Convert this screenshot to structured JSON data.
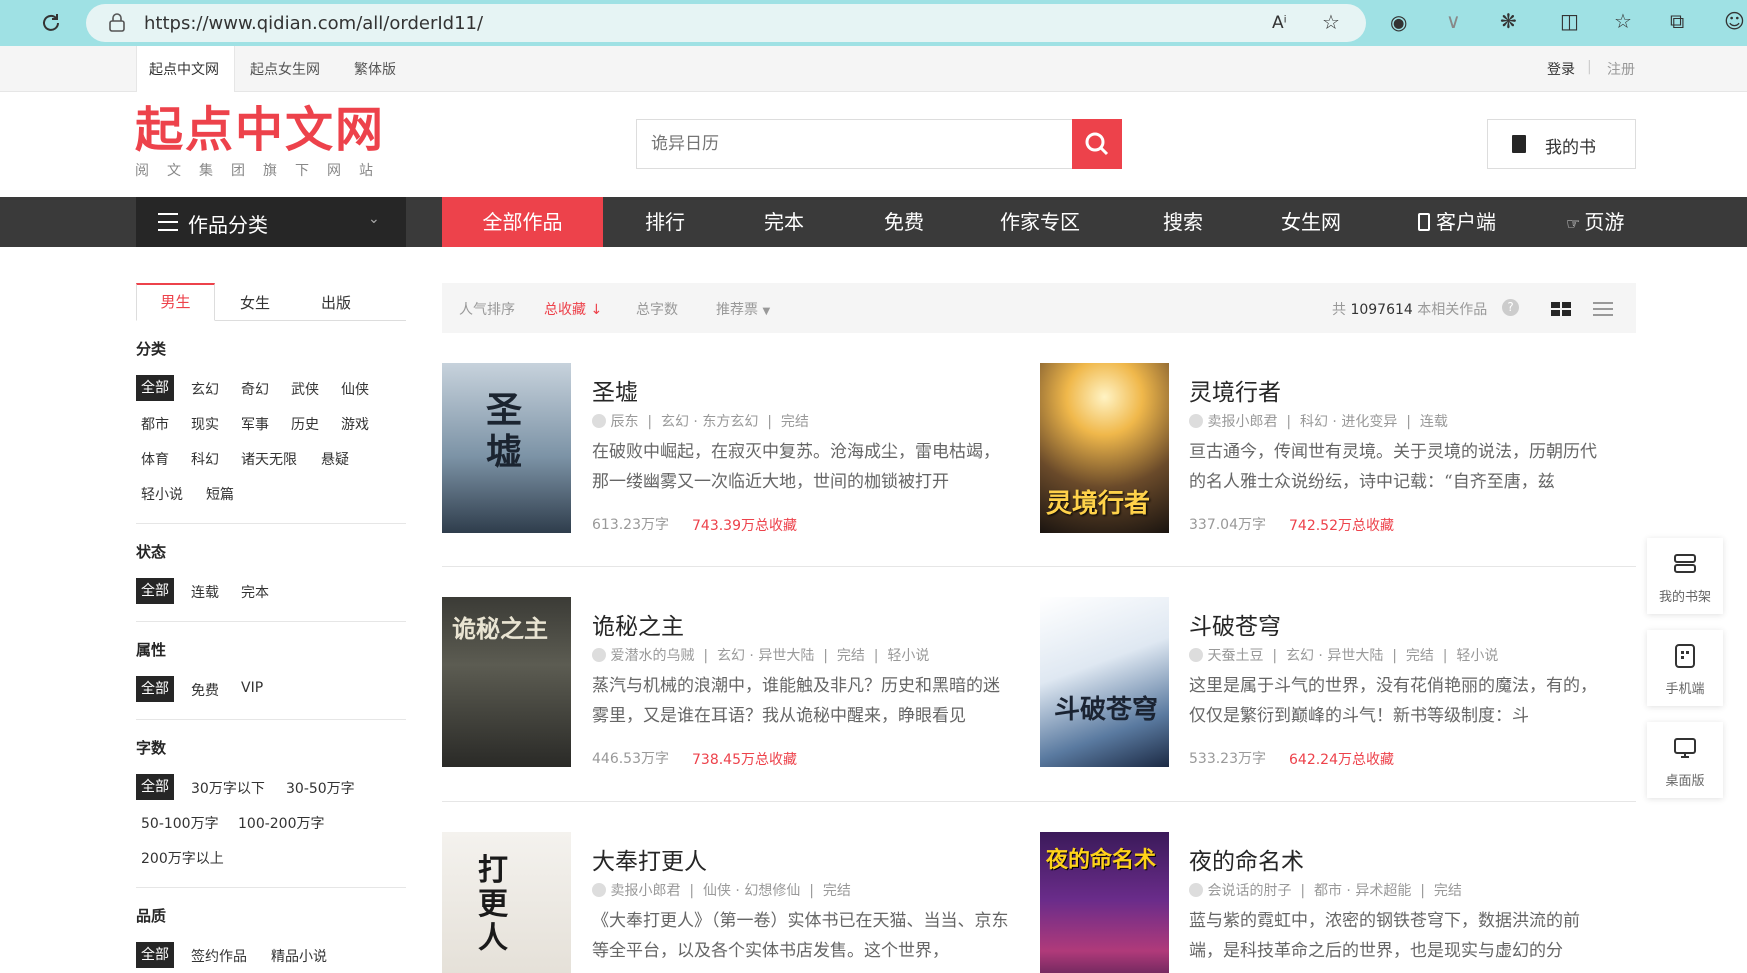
{
  "browser": {
    "url": "https://www.qidian.com/all/orderId11/"
  },
  "topbar": {
    "links": [
      "起点中文网",
      "起点女生网",
      "繁体版"
    ],
    "login": "登录",
    "register": "注册"
  },
  "header": {
    "logo_title": "起点中文网",
    "logo_subtitle": "阅文集团旗下网站",
    "search_placeholder": "诡异日历",
    "mybook_label": "我的书"
  },
  "nav": {
    "category_label": "作品分类",
    "items": [
      "全部作品",
      "排行",
      "完本",
      "免费",
      "作家专区",
      "搜索",
      "女生网",
      "客户端",
      "页游"
    ]
  },
  "filters": {
    "tabs": [
      "男生",
      "女生",
      "出版"
    ],
    "groups": [
      {
        "title": "分类",
        "options": [
          "全部",
          "玄幻",
          "奇幻",
          "武侠",
          "仙侠",
          "都市",
          "现实",
          "军事",
          "历史",
          "游戏",
          "体育",
          "科幻",
          "诸天无限",
          "悬疑",
          "轻小说",
          "短篇"
        ]
      },
      {
        "title": "状态",
        "options": [
          "全部",
          "连载",
          "完本"
        ]
      },
      {
        "title": "属性",
        "options": [
          "全部",
          "免费",
          "VIP"
        ]
      },
      {
        "title": "字数",
        "options": [
          "全部",
          "30万字以下",
          "30-50万字",
          "50-100万字",
          "100-200万字",
          "200万字以上"
        ]
      },
      {
        "title": "品质",
        "options": [
          "全部",
          "签约作品",
          "精品小说"
        ]
      }
    ]
  },
  "sortbar": {
    "options": [
      "人气排序",
      "总收藏",
      "总字数",
      "推荐票"
    ],
    "active": "总收藏",
    "total_prefix": "共",
    "total_count": "1097614",
    "total_suffix": "本相关作品"
  },
  "books": [
    {
      "title": "圣墟",
      "author": "辰东",
      "cat": "玄幻",
      "subcat": "东方玄幻",
      "status": "完结",
      "tag": "",
      "desc": "在破败中崛起，在寂灭中复苏。沧海成尘，雷电枯竭，那一缕幽雾又一次临近大地，世间的枷锁被打开",
      "words": "613.23万字",
      "collect": "743.39万总收藏",
      "cover_text": "圣墟"
    },
    {
      "title": "灵境行者",
      "author": "卖报小郎君",
      "cat": "科幻",
      "subcat": "进化变异",
      "status": "连载",
      "tag": "",
      "desc": "亘古通今，传闻世有灵境。关于灵境的说法，历朝历代的名人雅士众说纷纭，诗中记载：“自齐至唐，兹",
      "words": "337.04万字",
      "collect": "742.52万总收藏",
      "cover_text": "灵境行者"
    },
    {
      "title": "诡秘之主",
      "author": "爱潜水的乌贼",
      "cat": "玄幻",
      "subcat": "异世大陆",
      "status": "完结",
      "tag": "轻小说",
      "desc": "蒸汽与机械的浪潮中，谁能触及非凡？历史和黑暗的迷雾里，又是谁在耳语？我从诡秘中醒来，睁眼看见",
      "words": "446.53万字",
      "collect": "738.45万总收藏",
      "cover_text": "诡秘之主"
    },
    {
      "title": "斗破苍穹",
      "author": "天蚕土豆",
      "cat": "玄幻",
      "subcat": "异世大陆",
      "status": "完结",
      "tag": "轻小说",
      "desc": "这里是属于斗气的世界，没有花俏艳丽的魔法，有的，仅仅是繁衍到巅峰的斗气！新书等级制度：斗",
      "words": "533.23万字",
      "collect": "642.24万总收藏",
      "cover_text": "斗破苍穹"
    },
    {
      "title": "大奉打更人",
      "author": "卖报小郎君",
      "cat": "仙侠",
      "subcat": "幻想修仙",
      "status": "完结",
      "tag": "",
      "desc": "《大奉打更人》（第一卷）实体书已在天猫、当当、京东等全平台，以及各个实体书店发售。这个世界，",
      "words": "",
      "collect": "",
      "cover_text": "打更人"
    },
    {
      "title": "夜的命名术",
      "author": "会说话的肘子",
      "cat": "都市",
      "subcat": "异术超能",
      "status": "完结",
      "tag": "",
      "desc": "蓝与紫的霓虹中，浓密的钢铁苍穹下，数据洪流的前端，是科技革命之后的世界，也是现实与虚幻的分",
      "words": "",
      "collect": "",
      "cover_text": "夜的命名术"
    }
  ],
  "side_panel": [
    "我的书架",
    "手机端",
    "桌面版"
  ]
}
